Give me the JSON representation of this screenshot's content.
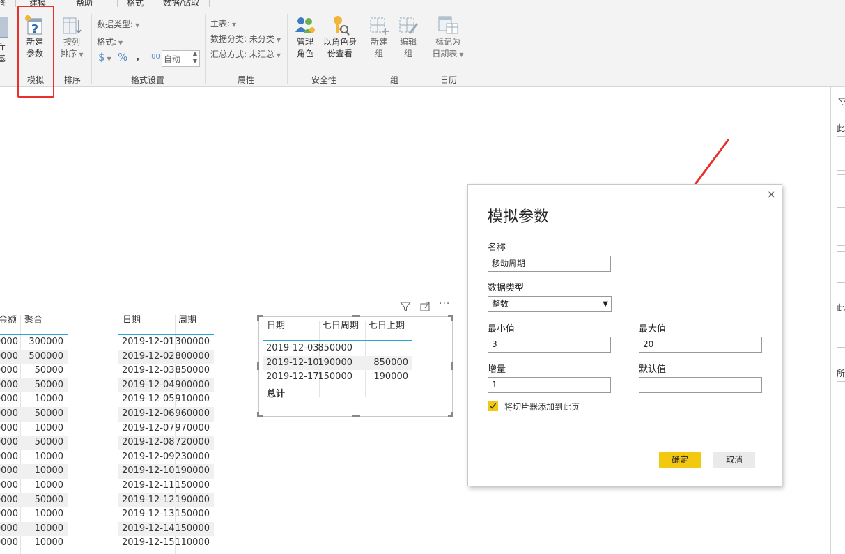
{
  "ribbon_tabs": [
    "图",
    "建模",
    "帮助",
    "格式",
    "数据/钻取"
  ],
  "ribbon": {
    "left_partial": [
      "斤",
      "基"
    ],
    "new_parameter": {
      "line1": "新建",
      "line2": "参数"
    },
    "sort_by_column": {
      "line1": "按列",
      "line2": "排序"
    },
    "data_type": "数据类型:",
    "format": "格式:",
    "currency_symbol": "$",
    "percent_symbol": "%",
    "comma_symbol": ",",
    "decimal_symbol": ".00",
    "auto_value": "自动",
    "home_table": "主表:",
    "data_category": "数据分类: 未分类",
    "summarize_by": "汇总方式: 未汇总",
    "manage_roles": {
      "line1": "管理",
      "line2": "角色"
    },
    "view_as_roles": {
      "line1": "以角色身",
      "line2": "份查看"
    },
    "new_group": {
      "line1": "新建",
      "line2": "组"
    },
    "edit_group": {
      "line1": "编辑",
      "line2": "组"
    },
    "mark_as_date_table": {
      "line1": "标记为",
      "line2": "日期表"
    },
    "groups": {
      "whatif": "模拟",
      "sort": "排序",
      "formatting": "格式设置",
      "properties": "属性",
      "security": "安全性",
      "groups": "组",
      "calendars": "日历"
    }
  },
  "table_left": {
    "headers": [
      "金额",
      "聚合"
    ],
    "rows": [
      [
        "0000",
        "300000"
      ],
      [
        "0000",
        "500000"
      ],
      [
        "0000",
        "50000"
      ],
      [
        "0000",
        "50000"
      ],
      [
        "0000",
        "10000"
      ],
      [
        "0000",
        "50000"
      ],
      [
        "0000",
        "10000"
      ],
      [
        "0000",
        "50000"
      ],
      [
        "0000",
        "10000"
      ],
      [
        "0000",
        "10000"
      ],
      [
        "0000",
        "10000"
      ],
      [
        "0000",
        "50000"
      ],
      [
        "0000",
        "10000"
      ],
      [
        "0000",
        "10000"
      ],
      [
        "0000",
        "10000"
      ]
    ]
  },
  "table_middle": {
    "headers": [
      "日期",
      "周期"
    ],
    "rows": [
      [
        "2019-12-01",
        "300000"
      ],
      [
        "2019-12-02",
        "800000"
      ],
      [
        "2019-12-03",
        "850000"
      ],
      [
        "2019-12-04",
        "900000"
      ],
      [
        "2019-12-05",
        "910000"
      ],
      [
        "2019-12-06",
        "960000"
      ],
      [
        "2019-12-07",
        "970000"
      ],
      [
        "2019-12-08",
        "720000"
      ],
      [
        "2019-12-09",
        "230000"
      ],
      [
        "2019-12-10",
        "190000"
      ],
      [
        "2019-12-11",
        "150000"
      ],
      [
        "2019-12-12",
        "190000"
      ],
      [
        "2019-12-13",
        "150000"
      ],
      [
        "2019-12-14",
        "150000"
      ],
      [
        "2019-12-15",
        "110000"
      ]
    ]
  },
  "visual_table": {
    "headers": [
      "日期",
      "七日周期",
      "七日上期"
    ],
    "rows": [
      [
        "2019-12-03",
        "850000",
        ""
      ],
      [
        "2019-12-10",
        "190000",
        "850000"
      ],
      [
        "2019-12-17",
        "150000",
        "190000"
      ]
    ],
    "total_label": "总计"
  },
  "dialog": {
    "title": "模拟参数",
    "close": "×",
    "name_label": "名称",
    "name_value": "移动周期",
    "datatype_label": "数据类型",
    "datatype_value": "整数",
    "min_label": "最小值",
    "min_value": "3",
    "max_label": "最大值",
    "max_value": "20",
    "increment_label": "增量",
    "increment_value": "1",
    "default_label": "默认值",
    "default_value": "",
    "add_slicer_label": "将切片器添加到此页",
    "add_slicer_checked": true,
    "ok": "确定",
    "cancel": "取消"
  },
  "right_pane": {
    "labels": [
      "此",
      "此",
      "所"
    ]
  },
  "colors": {
    "accent_yellow": "#f2c811",
    "header_line": "#28a7d8",
    "highlight_red": "#e8312c"
  }
}
